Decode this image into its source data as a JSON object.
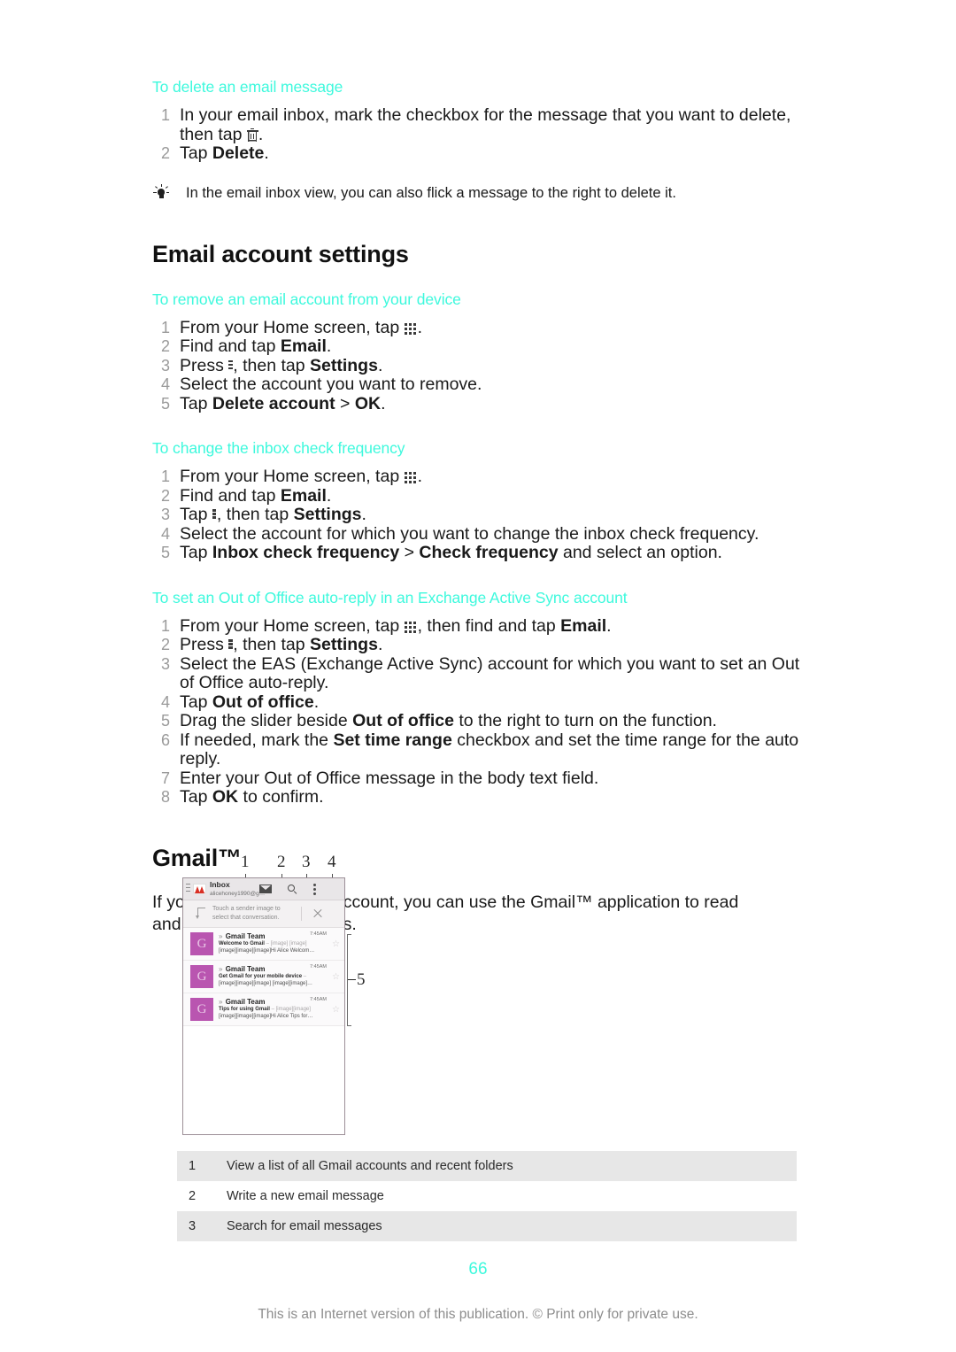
{
  "colors": {
    "accent_cyan": "#3EF9DD",
    "body_text": "#1a1a1a",
    "step_number": "#9a9a9a",
    "avatar_purple": "#b955b0",
    "table_shade": "#e7e7e7"
  },
  "sections": {
    "delete_email": {
      "heading": "To delete an email message",
      "steps": [
        {
          "parts": [
            {
              "t": "In your email inbox, mark the checkbox for the message that you want to delete, then tap "
            },
            {
              "icon": "trash-icon"
            },
            {
              "t": "."
            }
          ]
        },
        {
          "parts": [
            {
              "t": "Tap "
            },
            {
              "b": "Delete"
            },
            {
              "t": "."
            }
          ]
        }
      ],
      "tip": "In the email inbox view, you can also flick a message to the right to delete it."
    },
    "email_account_settings": {
      "title": "Email account settings",
      "remove_account": {
        "heading": "To remove an email account from your device",
        "steps": [
          {
            "parts": [
              {
                "t": "From your Home screen, tap "
              },
              {
                "icon": "app-drawer-icon"
              },
              {
                "t": "."
              }
            ]
          },
          {
            "parts": [
              {
                "t": "Find and tap "
              },
              {
                "b": "Email"
              },
              {
                "t": "."
              }
            ]
          },
          {
            "parts": [
              {
                "t": "Press "
              },
              {
                "icon": "kebab-menu-icon"
              },
              {
                "t": ", then tap "
              },
              {
                "b": "Settings"
              },
              {
                "t": "."
              }
            ]
          },
          {
            "parts": [
              {
                "t": "Select the account you want to remove."
              }
            ]
          },
          {
            "parts": [
              {
                "t": "Tap "
              },
              {
                "b": "Delete account"
              },
              {
                "t": " > "
              },
              {
                "b": "OK"
              },
              {
                "t": "."
              }
            ]
          }
        ]
      },
      "inbox_frequency": {
        "heading": "To change the inbox check frequency",
        "steps": [
          {
            "parts": [
              {
                "t": "From your Home screen, tap "
              },
              {
                "icon": "app-drawer-icon"
              },
              {
                "t": "."
              }
            ]
          },
          {
            "parts": [
              {
                "t": "Find and tap "
              },
              {
                "b": "Email"
              },
              {
                "t": "."
              }
            ]
          },
          {
            "parts": [
              {
                "t": "Tap "
              },
              {
                "icon": "kebab-menu-icon"
              },
              {
                "t": ", then tap "
              },
              {
                "b": "Settings"
              },
              {
                "t": "."
              }
            ]
          },
          {
            "parts": [
              {
                "t": "Select the account for which you want to change the inbox check frequency."
              }
            ]
          },
          {
            "parts": [
              {
                "t": "Tap "
              },
              {
                "b": "Inbox check frequency"
              },
              {
                "t": " > "
              },
              {
                "b": "Check frequency"
              },
              {
                "t": " and select an option."
              }
            ]
          }
        ]
      },
      "out_of_office": {
        "heading": "To set an Out of Office auto-reply in an Exchange Active Sync account",
        "steps": [
          {
            "parts": [
              {
                "t": "From your Home screen, tap "
              },
              {
                "icon": "app-drawer-icon"
              },
              {
                "t": ", then find and tap "
              },
              {
                "b": "Email"
              },
              {
                "t": "."
              }
            ]
          },
          {
            "parts": [
              {
                "t": "Press "
              },
              {
                "icon": "kebab-menu-icon"
              },
              {
                "t": ", then tap "
              },
              {
                "b": "Settings"
              },
              {
                "t": "."
              }
            ]
          },
          {
            "parts": [
              {
                "t": "Select the EAS (Exchange Active Sync) account for which you want to set an Out of Office auto-reply."
              }
            ]
          },
          {
            "parts": [
              {
                "t": "Tap "
              },
              {
                "b": "Out of office"
              },
              {
                "t": "."
              }
            ]
          },
          {
            "parts": [
              {
                "t": "Drag the slider beside "
              },
              {
                "b": "Out of office"
              },
              {
                "t": " to the right to turn on the function."
              }
            ]
          },
          {
            "parts": [
              {
                "t": "If needed, mark the "
              },
              {
                "b": "Set time range"
              },
              {
                "t": " checkbox and set the time range for the auto reply."
              }
            ]
          },
          {
            "parts": [
              {
                "t": "Enter your Out of Office message in the body text field."
              }
            ]
          },
          {
            "parts": [
              {
                "t": "Tap "
              },
              {
                "b": "OK"
              },
              {
                "t": " to confirm."
              }
            ]
          }
        ]
      }
    },
    "gmail": {
      "title": "Gmail™",
      "intro": "If you have a Google™ account, you can use the Gmail™ application to read and write email messages."
    }
  },
  "figure": {
    "callout_numbers": [
      "1",
      "2",
      "3",
      "4"
    ],
    "bracket_number": "5",
    "phone": {
      "topbar": {
        "title": "Inbox",
        "account": "alicehoney1990@g…"
      },
      "hint": {
        "line1": "Touch a sender image to",
        "line2": "select that conversation."
      },
      "messages": [
        {
          "avatar": "G",
          "sender": "Gmail Team",
          "time": "7:45AM",
          "subject": "Welcome to Gmail",
          "snippet_line1": " – [image] [image]",
          "snippet_line2": "[image][image][image]Hi Alice Welcom…"
        },
        {
          "avatar": "G",
          "sender": "Gmail Team",
          "time": "7:45AM",
          "subject": "Get Gmail for your mobile device",
          "snippet_line1": " –",
          "snippet_line2": "[image][image][image] [image][image]…"
        },
        {
          "avatar": "G",
          "sender": "Gmail Team",
          "time": "7:45AM",
          "subject": "Tips for using Gmail",
          "snippet_line1": " – [image][image]",
          "snippet_line2": "[image][image][image]Hi Alice Tips for…"
        }
      ]
    }
  },
  "legend": [
    {
      "num": "1",
      "text": "View a list of all Gmail accounts and recent folders"
    },
    {
      "num": "2",
      "text": "Write a new email message"
    },
    {
      "num": "3",
      "text": "Search for email messages"
    }
  ],
  "footer": {
    "page_number": "66",
    "copyright": "This is an Internet version of this publication. © Print only for private use."
  }
}
